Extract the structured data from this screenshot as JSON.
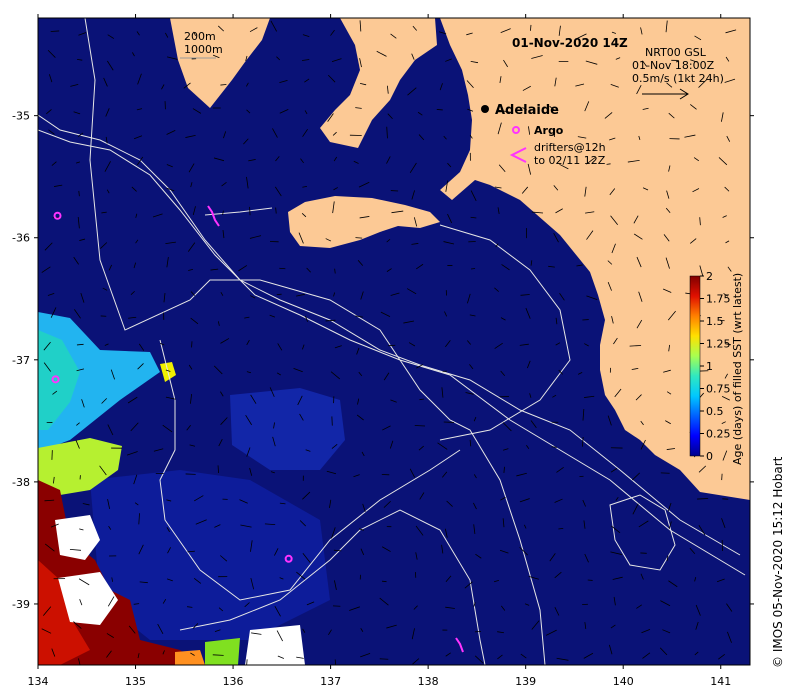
{
  "map": {
    "title": "01-Nov-2020 14Z",
    "depth_legend": [
      "200m",
      "1000m"
    ],
    "current_label": [
      "NRT00 GSL",
      "01-Nov 18:00Z",
      "0.5m/s (1kt 24h)"
    ],
    "city": "Adelaide",
    "argo_label": "Argo",
    "drifter_label": [
      "drifters@12h",
      "to 02/11 12Z"
    ],
    "credit": "© IMOS 05-Nov-2020 15:12 Hobart",
    "colors": {
      "ocean": "#0a1277",
      "land": "#fcc995",
      "contour": "#e6e6e6",
      "argo": "#ff33ff",
      "drifter": "#ff33ff"
    }
  },
  "axes": {
    "x_ticks": [
      "134",
      "135",
      "136",
      "137",
      "138",
      "139",
      "140",
      "141"
    ],
    "y_ticks": [
      "-35",
      "-36",
      "-37",
      "-38",
      "-39"
    ],
    "x_range": [
      134,
      141.3
    ],
    "y_range": [
      -39.5,
      -34.2
    ]
  },
  "colorbar": {
    "label": "Age (days) of filled SST (wrt latest)",
    "ticks": [
      "0",
      "0.25",
      "0.5",
      "0.75",
      "1",
      "1.25",
      "1.5",
      "1.75",
      "2"
    ],
    "range": [
      0,
      2
    ],
    "stops": [
      "#00008c",
      "#0000ff",
      "#0060ff",
      "#00c8ff",
      "#30e8c0",
      "#a8ff50",
      "#ffe000",
      "#ff8000",
      "#e01000",
      "#800000"
    ]
  },
  "chart_data": {
    "type": "heatmap",
    "title": "01-Nov-2020 14Z",
    "xlabel": "",
    "ylabel": "",
    "x_ticks": [
      134,
      135,
      136,
      137,
      138,
      139,
      140,
      141
    ],
    "y_ticks": [
      -35,
      -36,
      -37,
      -38,
      -39
    ],
    "colorbar_label": "Age (days) of filled SST (wrt latest)",
    "colorbar_range": [
      0,
      2
    ],
    "places": [
      {
        "name": "Adelaide",
        "lon": 138.6,
        "lat": -34.93
      }
    ],
    "argo_floats": [
      {
        "lon": 134.2,
        "lat": -35.82
      },
      {
        "lon": 134.18,
        "lat": -37.16
      },
      {
        "lon": 136.57,
        "lat": -38.63
      },
      {
        "lon": 138.88,
        "lat": -35.1
      }
    ]
  }
}
